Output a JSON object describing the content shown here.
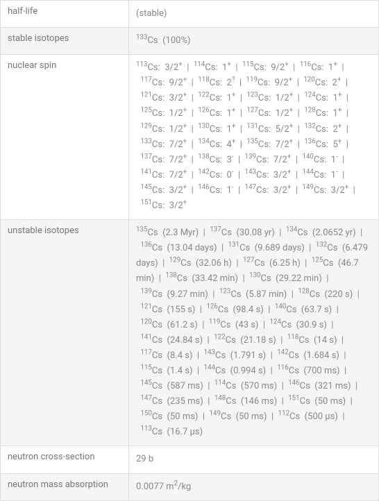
{
  "rows": [
    {
      "label": "half-life",
      "value_html": "(stable)"
    },
    {
      "label": "stable isotopes",
      "value_html": "<span class='sup'>133</span>Cs&nbsp;&nbsp;(100%)"
    },
    {
      "label": "nuclear spin",
      "value_html": "<span class='sup'>113</span>Cs:&nbsp;&nbsp;3/2<span class='sup'>+</span>&nbsp;&nbsp;|&nbsp;&nbsp;<span class='sup'>114</span>Cs:&nbsp;&nbsp;1<span class='sup'>+</span>&nbsp;&nbsp;|&nbsp;&nbsp;<span class='sup'>115</span>Cs:&nbsp;&nbsp;9/2<span class='sup'>+</span>&nbsp;&nbsp;|&nbsp;&nbsp;<span class='sup'>116</span>Cs:&nbsp;&nbsp;1<span class='sup'>+</span>&nbsp;&nbsp;|&nbsp;&nbsp;<span class='sup'>117</span>Cs:&nbsp;&nbsp;9/2<span class='sup'>+</span>&nbsp;&nbsp;|&nbsp;&nbsp;<span class='sup'>118</span>Cs:&nbsp;&nbsp;2<span class='sup'>?</span>&nbsp;&nbsp;|&nbsp;&nbsp;<span class='sup'>119</span>Cs:&nbsp;&nbsp;9/2<span class='sup'>+</span>&nbsp;&nbsp;|&nbsp;&nbsp;<span class='sup'>120</span>Cs:&nbsp;&nbsp;2<span class='sup'>+</span>&nbsp;&nbsp;|&nbsp;&nbsp;<span class='sup'>121</span>Cs:&nbsp;&nbsp;3/2<span class='sup'>+</span>&nbsp;&nbsp;|&nbsp;&nbsp;<span class='sup'>122</span>Cs:&nbsp;&nbsp;1<span class='sup'>+</span>&nbsp;&nbsp;|&nbsp;&nbsp;<span class='sup'>123</span>Cs:&nbsp;&nbsp;1/2<span class='sup'>+</span>&nbsp;&nbsp;|&nbsp;&nbsp;<span class='sup'>124</span>Cs:&nbsp;&nbsp;1<span class='sup'>+</span>&nbsp;&nbsp;|&nbsp;&nbsp;<span class='sup'>125</span>Cs:&nbsp;&nbsp;1/2<span class='sup'>+</span>&nbsp;&nbsp;|&nbsp;&nbsp;<span class='sup'>126</span>Cs:&nbsp;&nbsp;1<span class='sup'>+</span>&nbsp;&nbsp;|&nbsp;&nbsp;<span class='sup'>127</span>Cs:&nbsp;&nbsp;1/2<span class='sup'>+</span>&nbsp;&nbsp;|&nbsp;&nbsp;<span class='sup'>128</span>Cs:&nbsp;&nbsp;1<span class='sup'>+</span>&nbsp;&nbsp;|&nbsp;&nbsp;<span class='sup'>129</span>Cs:&nbsp;&nbsp;1/2<span class='sup'>+</span>&nbsp;&nbsp;|&nbsp;&nbsp;<span class='sup'>130</span>Cs:&nbsp;&nbsp;1<span class='sup'>+</span>&nbsp;&nbsp;|&nbsp;&nbsp;<span class='sup'>131</span>Cs:&nbsp;&nbsp;5/2<span class='sup'>+</span>&nbsp;&nbsp;|&nbsp;&nbsp;<span class='sup'>132</span>Cs:&nbsp;&nbsp;2<span class='sup'>+</span>&nbsp;&nbsp;|&nbsp;&nbsp;<span class='sup'>133</span>Cs:&nbsp;&nbsp;7/2<span class='sup'>+</span>&nbsp;&nbsp;|&nbsp;&nbsp;<span class='sup'>134</span>Cs:&nbsp;&nbsp;4<span class='sup'>+</span>&nbsp;&nbsp;|&nbsp;&nbsp;<span class='sup'>135</span>Cs:&nbsp;&nbsp;7/2<span class='sup'>+</span>&nbsp;&nbsp;|&nbsp;&nbsp;<span class='sup'>136</span>Cs:&nbsp;&nbsp;5<span class='sup'>+</span>&nbsp;&nbsp;|&nbsp;&nbsp;<span class='sup'>137</span>Cs:&nbsp;&nbsp;7/2<span class='sup'>+</span>&nbsp;&nbsp;|&nbsp;&nbsp;<span class='sup'>138</span>Cs:&nbsp;&nbsp;3<span class='sup'>-</span>&nbsp;&nbsp;|&nbsp;&nbsp;<span class='sup'>139</span>Cs:&nbsp;&nbsp;7/2<span class='sup'>+</span>&nbsp;&nbsp;|&nbsp;&nbsp;<span class='sup'>140</span>Cs:&nbsp;&nbsp;1<span class='sup'>-</span>&nbsp;&nbsp;|&nbsp;&nbsp;<span class='sup'>141</span>Cs:&nbsp;&nbsp;7/2<span class='sup'>+</span>&nbsp;&nbsp;|&nbsp;&nbsp;<span class='sup'>142</span>Cs:&nbsp;&nbsp;0<span class='sup'>-</span>&nbsp;&nbsp;|&nbsp;&nbsp;<span class='sup'>143</span>Cs:&nbsp;&nbsp;3/2<span class='sup'>+</span>&nbsp;&nbsp;|&nbsp;&nbsp;<span class='sup'>144</span>Cs:&nbsp;&nbsp;1<span class='sup'>-</span>&nbsp;&nbsp;|&nbsp;&nbsp;<span class='sup'>145</span>Cs:&nbsp;&nbsp;3/2<span class='sup'>+</span>&nbsp;&nbsp;|&nbsp;&nbsp;<span class='sup'>146</span>Cs:&nbsp;&nbsp;1<span class='sup'>-</span>&nbsp;&nbsp;|&nbsp;&nbsp;<span class='sup'>147</span>Cs:&nbsp;&nbsp;3/2<span class='sup'>+</span>&nbsp;&nbsp;|&nbsp;&nbsp;<span class='sup'>149</span>Cs:&nbsp;&nbsp;3/2<span class='sup'>+</span>&nbsp;&nbsp;|&nbsp;&nbsp;<span class='sup'>151</span>Cs:&nbsp;&nbsp;3/2<span class='sup'>+</span>"
    },
    {
      "label": "unstable isotopes",
      "value_html": "<span class='sup'>135</span>Cs&nbsp;&nbsp;(2.3 Myr)&nbsp;&nbsp;|&nbsp;&nbsp;<span class='sup'>137</span>Cs&nbsp;&nbsp;(30.08 yr)&nbsp;&nbsp;|&nbsp;&nbsp;<span class='sup'>134</span>Cs&nbsp;&nbsp;(2.0652 yr)&nbsp;&nbsp;|&nbsp;&nbsp;<span class='sup'>136</span>Cs&nbsp;&nbsp;(13.04 days)&nbsp;&nbsp;|&nbsp;&nbsp;<span class='sup'>131</span>Cs&nbsp;&nbsp;(9.689 days)&nbsp;&nbsp;|&nbsp;&nbsp;<span class='sup'>132</span>Cs&nbsp;&nbsp;(6.479 days)&nbsp;&nbsp;|&nbsp;&nbsp;<span class='sup'>129</span>Cs&nbsp;&nbsp;(32.06 h)&nbsp;&nbsp;|&nbsp;&nbsp;<span class='sup'>127</span>Cs&nbsp;&nbsp;(6.25 h)&nbsp;&nbsp;|&nbsp;&nbsp;<span class='sup'>125</span>Cs&nbsp;&nbsp;(46.7 min)&nbsp;&nbsp;|&nbsp;&nbsp;<span class='sup'>138</span>Cs&nbsp;&nbsp;(33.42 min)&nbsp;&nbsp;|&nbsp;&nbsp;<span class='sup'>130</span>Cs&nbsp;&nbsp;(29.22 min)&nbsp;&nbsp;|&nbsp;&nbsp;<span class='sup'>139</span>Cs&nbsp;&nbsp;(9.27 min)&nbsp;&nbsp;|&nbsp;&nbsp;<span class='sup'>123</span>Cs&nbsp;&nbsp;(5.87 min)&nbsp;&nbsp;|&nbsp;&nbsp;<span class='sup'>128</span>Cs&nbsp;&nbsp;(220 s)&nbsp;&nbsp;|&nbsp;&nbsp;<span class='sup'>121</span>Cs&nbsp;&nbsp;(155 s)&nbsp;&nbsp;|&nbsp;&nbsp;<span class='sup'>126</span>Cs&nbsp;&nbsp;(98.4 s)&nbsp;&nbsp;|&nbsp;&nbsp;<span class='sup'>140</span>Cs&nbsp;&nbsp;(63.7 s)&nbsp;&nbsp;|&nbsp;&nbsp;<span class='sup'>120</span>Cs&nbsp;&nbsp;(61.2 s)&nbsp;&nbsp;|&nbsp;&nbsp;<span class='sup'>119</span>Cs&nbsp;&nbsp;(43 s)&nbsp;&nbsp;|&nbsp;&nbsp;<span class='sup'>124</span>Cs&nbsp;&nbsp;(30.9 s)&nbsp;&nbsp;|&nbsp;&nbsp;<span class='sup'>141</span>Cs&nbsp;&nbsp;(24.84 s)&nbsp;&nbsp;|&nbsp;&nbsp;<span class='sup'>122</span>Cs&nbsp;&nbsp;(21.18 s)&nbsp;&nbsp;|&nbsp;&nbsp;<span class='sup'>118</span>Cs&nbsp;&nbsp;(14 s)&nbsp;&nbsp;|&nbsp;&nbsp;<span class='sup'>117</span>Cs&nbsp;&nbsp;(8.4 s)&nbsp;&nbsp;|&nbsp;&nbsp;<span class='sup'>143</span>Cs&nbsp;&nbsp;(1.791 s)&nbsp;&nbsp;|&nbsp;&nbsp;<span class='sup'>142</span>Cs&nbsp;&nbsp;(1.684 s)&nbsp;&nbsp;|&nbsp;&nbsp;<span class='sup'>115</span>Cs&nbsp;&nbsp;(1.4 s)&nbsp;&nbsp;|&nbsp;&nbsp;<span class='sup'>144</span>Cs&nbsp;&nbsp;(0.994 s)&nbsp;&nbsp;|&nbsp;&nbsp;<span class='sup'>116</span>Cs&nbsp;&nbsp;(700 ms)&nbsp;&nbsp;|&nbsp;&nbsp;<span class='sup'>145</span>Cs&nbsp;&nbsp;(587 ms)&nbsp;&nbsp;|&nbsp;&nbsp;<span class='sup'>114</span>Cs&nbsp;&nbsp;(570 ms)&nbsp;&nbsp;|&nbsp;&nbsp;<span class='sup'>146</span>Cs&nbsp;&nbsp;(321 ms)&nbsp;&nbsp;|&nbsp;&nbsp;<span class='sup'>147</span>Cs&nbsp;&nbsp;(235 ms)&nbsp;&nbsp;|&nbsp;&nbsp;<span class='sup'>148</span>Cs&nbsp;&nbsp;(146 ms)&nbsp;&nbsp;|&nbsp;&nbsp;<span class='sup'>151</span>Cs&nbsp;&nbsp;(50 ms)&nbsp;&nbsp;|&nbsp;&nbsp;<span class='sup'>150</span>Cs&nbsp;&nbsp;(50 ms)&nbsp;&nbsp;|&nbsp;&nbsp;<span class='sup'>149</span>Cs&nbsp;&nbsp;(50 ms)&nbsp;&nbsp;|&nbsp;&nbsp;<span class='sup'>112</span>Cs&nbsp;&nbsp;(500 μs)&nbsp;&nbsp;|&nbsp;&nbsp;<span class='sup'>113</span>Cs&nbsp;&nbsp;(16.7 μs)"
    },
    {
      "label": "neutron cross-section",
      "value_html": "29 b"
    },
    {
      "label": "neutron mass absorption",
      "value_html": "0.0077 m<span class='sup'>2</span>/kg"
    }
  ]
}
